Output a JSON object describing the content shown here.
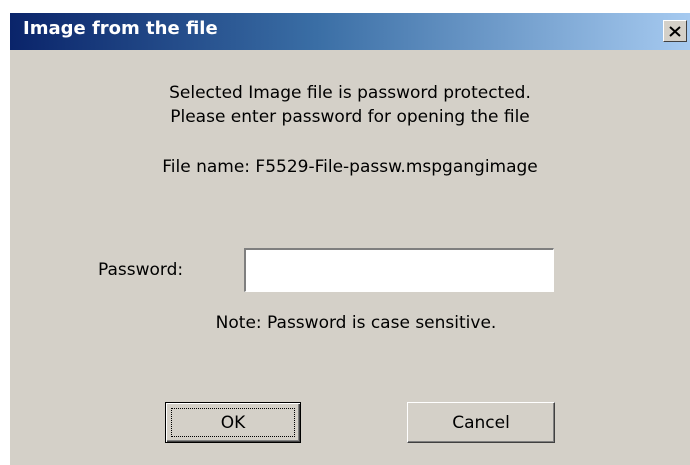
{
  "window": {
    "title": "Image from the file",
    "close_icon": "close-icon"
  },
  "message": {
    "line1": "Selected Image file is password protected.",
    "line2": "Please enter password for opening the file",
    "file_name": "File name: F5529-File-passw.mspgangimage"
  },
  "password": {
    "label": "Password:",
    "value": "",
    "note": "Note: Password is case sensitive."
  },
  "buttons": {
    "ok_label": "OK",
    "cancel_label": "Cancel"
  },
  "colors": {
    "dialog_bg": "#d4d0c8",
    "titlebar_start": "#0a246a",
    "titlebar_end": "#a6caf0",
    "title_text": "#ffffff"
  }
}
